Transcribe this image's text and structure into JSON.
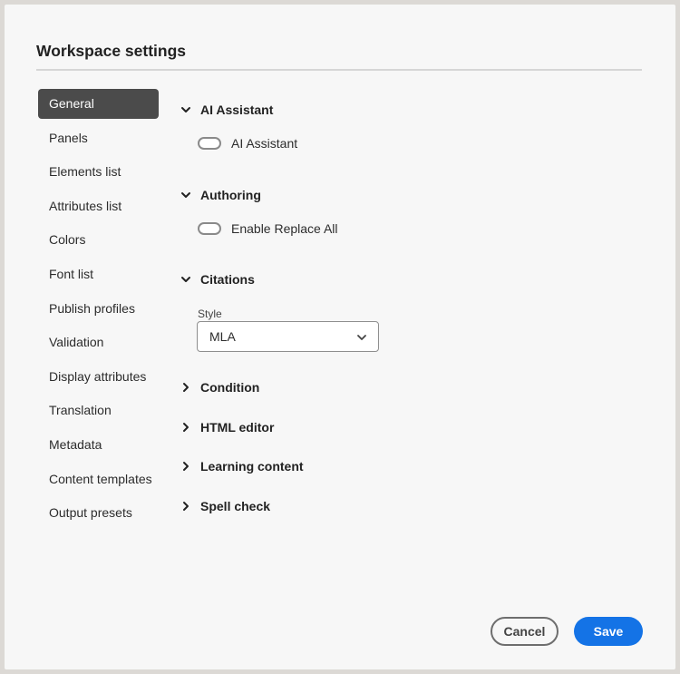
{
  "dialog": {
    "title": "Workspace settings"
  },
  "sidebar": {
    "items": [
      {
        "label": "General",
        "active": true
      },
      {
        "label": "Panels"
      },
      {
        "label": "Elements list"
      },
      {
        "label": "Attributes list"
      },
      {
        "label": "Colors"
      },
      {
        "label": "Font list"
      },
      {
        "label": "Publish profiles"
      },
      {
        "label": "Validation"
      },
      {
        "label": "Display attributes"
      },
      {
        "label": "Translation"
      },
      {
        "label": "Metadata"
      },
      {
        "label": "Content templates"
      },
      {
        "label": "Output presets"
      }
    ]
  },
  "sections": {
    "ai_assistant": {
      "label": "AI Assistant",
      "expanded": true,
      "toggle_label": "AI Assistant",
      "toggle_on": false
    },
    "authoring": {
      "label": "Authoring",
      "expanded": true,
      "toggle_label": "Enable Replace All",
      "toggle_on": false
    },
    "citations": {
      "label": "Citations",
      "expanded": true,
      "style_label": "Style",
      "style_value": "MLA"
    },
    "condition": {
      "label": "Condition",
      "expanded": false
    },
    "html_editor": {
      "label": "HTML editor",
      "expanded": false
    },
    "learning_content": {
      "label": "Learning content",
      "expanded": false
    },
    "spell_check": {
      "label": "Spell check",
      "expanded": false
    }
  },
  "footer": {
    "cancel_label": "Cancel",
    "save_label": "Save"
  },
  "colors": {
    "accent": "#1473e6",
    "active_nav": "#4b4b4b"
  }
}
